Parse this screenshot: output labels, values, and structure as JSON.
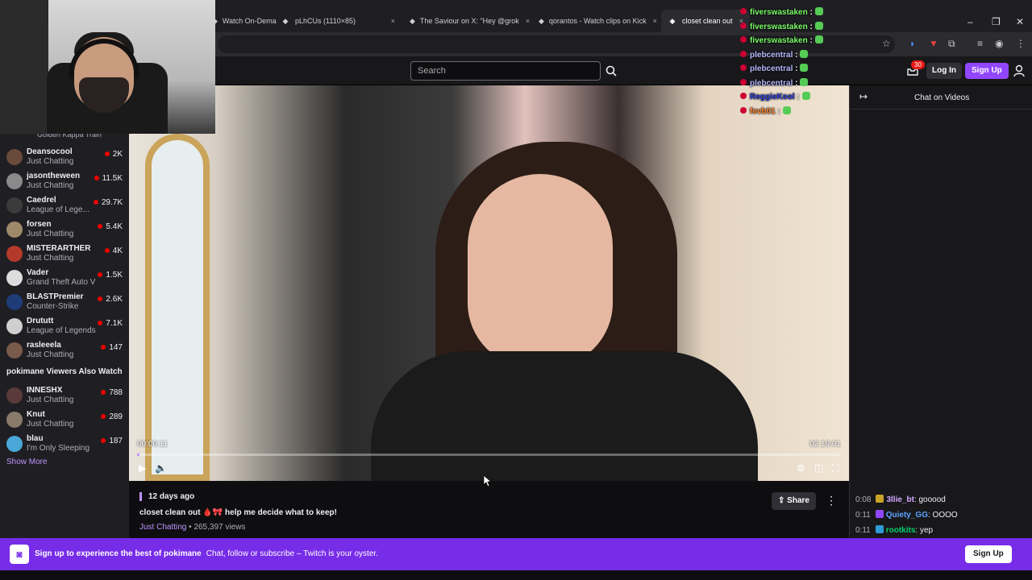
{
  "browser": {
    "tabs": [
      {
        "label": "Watch On-Dema",
        "icon": "twitch-icon"
      },
      {
        "label": "pLhCUs (1110×85)",
        "icon": "image-icon"
      },
      {
        "label": "The Saviour on X: \"Hey @grok",
        "icon": "x-icon"
      },
      {
        "label": "qorantos - Watch clips on Kick",
        "icon": "kick-icon"
      },
      {
        "label": "closet clean out",
        "icon": "twitch-icon"
      }
    ],
    "close_glyph": "×",
    "window_controls": [
      "–",
      "❐",
      "✕"
    ]
  },
  "topnav": {
    "search_placeholder": "Search",
    "notification_count": "30",
    "login": "Log In",
    "signup": "Sign Up"
  },
  "sidebar": {
    "top_partial": "Golden Kappa Train",
    "followed": [
      {
        "name": "Deansocool",
        "game": "Just Chatting",
        "viewers": "2K",
        "color": "#6a4a3a"
      },
      {
        "name": "jasontheween",
        "game": "Just Chatting",
        "viewers": "11.5K",
        "color": "#8a8a8a"
      },
      {
        "name": "Caedrel",
        "game": "League of Lege...",
        "viewers": "29.7K",
        "color": "#3b3b3b"
      },
      {
        "name": "forsen",
        "game": "Just Chatting",
        "viewers": "5.4K",
        "color": "#9e8a6a"
      },
      {
        "name": "MISTERARTHER",
        "game": "Just Chatting",
        "viewers": "4K",
        "color": "#b33a2a"
      },
      {
        "name": "Vader",
        "game": "Grand Theft Auto V",
        "viewers": "1.5K",
        "color": "#dddddd"
      },
      {
        "name": "BLASTPremier",
        "game": "Counter-Strike",
        "viewers": "2.6K",
        "color": "#1e3c78"
      },
      {
        "name": "Drututt",
        "game": "League of Legends",
        "viewers": "7.1K",
        "color": "#cfcfcf"
      },
      {
        "name": "rasleeela",
        "game": "Just Chatting",
        "viewers": "147",
        "color": "#7a5a4a"
      }
    ],
    "also_watch_title": "pokimane Viewers Also Watch",
    "also_watch": [
      {
        "name": "INNESHX",
        "game": "Just Chatting",
        "viewers": "788",
        "color": "#5a3a3a"
      },
      {
        "name": "Knut",
        "game": "Just Chatting",
        "viewers": "289",
        "color": "#8a7a6a"
      },
      {
        "name": "blau",
        "game": "I'm Only Sleeping",
        "viewers": "187",
        "color": "#4aa8d8"
      }
    ],
    "show_more": "Show More"
  },
  "player": {
    "elapsed": "00:00:11",
    "duration": "02:19:01",
    "progress": 0.0013
  },
  "video": {
    "ago": "12 days ago",
    "title": "closet clean out 🩸🎀 help me decide what to keep!",
    "category": "Just Chatting",
    "views": " • 265,397 views",
    "share": "Share"
  },
  "chat": {
    "header": "Chat on Videos",
    "messages": [
      {
        "ts": "0:08",
        "user": "3llie_bt",
        "text": " gooood",
        "color": "#d2a8ff",
        "badge": "#c9a227"
      },
      {
        "ts": "0:11",
        "user": "Quiety_GG",
        "text": " OOOO",
        "color": "#5ca3ff",
        "badge": "#9147ff"
      },
      {
        "ts": "0:11",
        "user": "rootkits",
        "text": " yep",
        "color": "#00d26a",
        "badge": "#2e9bd6"
      }
    ]
  },
  "overlay_chat": [
    {
      "user": "fiverswastaken",
      "color": "#7dff6a"
    },
    {
      "user": "fiverswastaken",
      "color": "#7dff6a"
    },
    {
      "user": "fiverswastaken",
      "color": "#7dff6a"
    },
    {
      "user": "plebcentral",
      "color": "#b9b9ff"
    },
    {
      "user": "plebcentral",
      "color": "#b9b9ff"
    },
    {
      "user": "plebcentral",
      "color": "#b9b9ff"
    },
    {
      "user": "ReggieKool",
      "color": "#2a3ad8"
    },
    {
      "user": "fevb01",
      "color": "#ff8a3a"
    }
  ],
  "banner": {
    "title": "Sign up to experience the best of pokimane",
    "subtitle": "Chat, follow or subscribe – Twitch is your oyster.",
    "signup": "Sign Up"
  }
}
